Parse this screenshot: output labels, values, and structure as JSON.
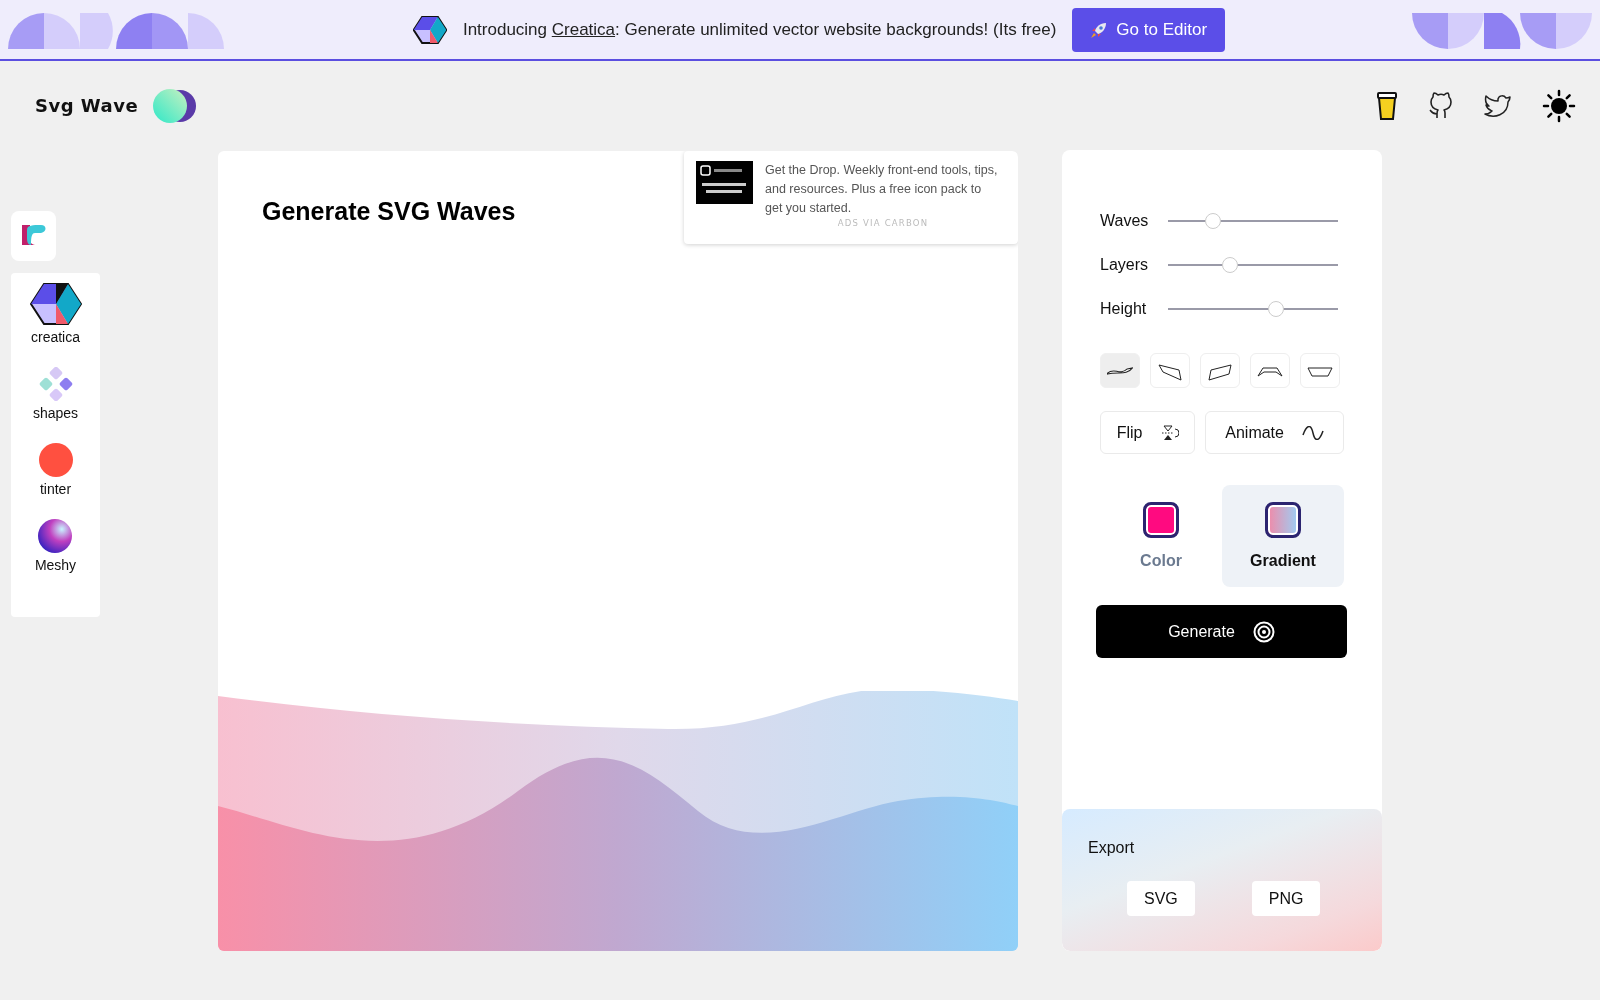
{
  "banner": {
    "before": "Introducing ",
    "link": "Creatica",
    "after": ": Generate unlimited vector website backgrounds! (Its free)",
    "button": "Go to Editor"
  },
  "header": {
    "logo": "Svg Wave"
  },
  "sidebar": {
    "items": [
      {
        "label": "creatica",
        "kind": "creatica"
      },
      {
        "label": "shapes",
        "kind": "shapes"
      },
      {
        "label": "tinter",
        "kind": "tinter"
      },
      {
        "label": "Meshy",
        "kind": "meshy"
      }
    ]
  },
  "canvas": {
    "title": "Generate SVG Waves"
  },
  "ad": {
    "text": "Get the Drop. Weekly front-end tools, tips, and resources. Plus a free icon pack to get you started.",
    "via": "ADS VIA CARBON"
  },
  "sliders": [
    {
      "label": "Waves",
      "level": 0.24
    },
    {
      "label": "Layers",
      "level": 0.35
    },
    {
      "label": "Height",
      "level": 0.65
    }
  ],
  "shapes": [
    {
      "kind": "wave",
      "selected": true
    },
    {
      "kind": "skew-down",
      "selected": false
    },
    {
      "kind": "skew-up",
      "selected": false
    },
    {
      "kind": "arch",
      "selected": false
    },
    {
      "kind": "bowl",
      "selected": false
    }
  ],
  "actions": [
    {
      "label": "Flip",
      "kind": "flip"
    },
    {
      "label": "Animate",
      "kind": "animate"
    }
  ],
  "fills": [
    {
      "label": "Color",
      "kind": "solid",
      "selected": false
    },
    {
      "label": "Gradient",
      "kind": "gradient",
      "selected": true
    }
  ],
  "generate": "Generate",
  "export": {
    "title": "Export",
    "buttons": [
      "SVG",
      "PNG"
    ]
  }
}
